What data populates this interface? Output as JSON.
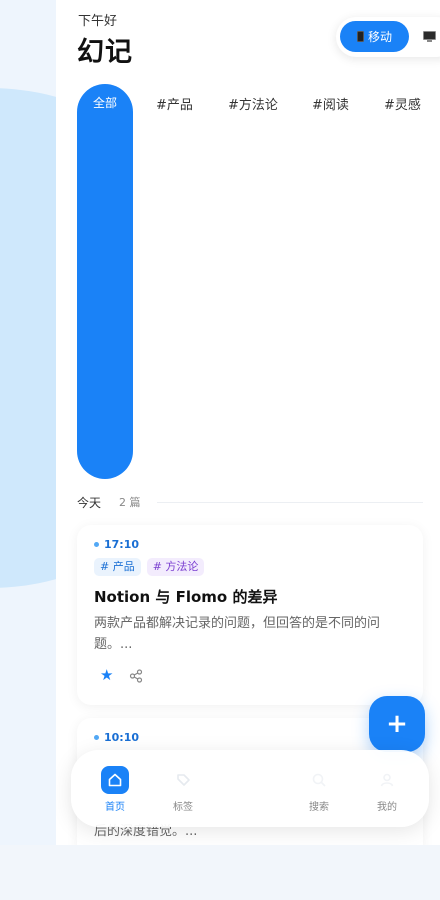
{
  "header": {
    "greeting": "下午好",
    "title": "幻记"
  },
  "view_switch": {
    "mobile_label": "移动",
    "active": "mobile"
  },
  "tags": {
    "active": "全部",
    "items": [
      "#产品",
      "#方法论",
      "#阅读",
      "#灵感"
    ]
  },
  "section": {
    "title": "今天",
    "count": "2 篇"
  },
  "notes": [
    {
      "time": "17:10",
      "tags": [
        "# 产品",
        "# 方法论"
      ],
      "title": "Notion 与 Flomo 的差异",
      "body": "两款产品都解决记录的问题，但回答的是不同的问题。..."
    },
    {
      "time": "10:10",
      "body_tail": "后的深度错觉。..."
    }
  ],
  "bottom_nav": {
    "items": [
      {
        "label": "首页",
        "icon": "home-icon",
        "active": true
      },
      {
        "label": "标签",
        "icon": "tag-icon",
        "active": false
      },
      {
        "label": "搜索",
        "icon": "search-icon",
        "active": false
      },
      {
        "label": "我的",
        "icon": "user-icon",
        "active": false
      }
    ]
  },
  "colors": {
    "accent": "#1a82f7",
    "tag_blue_bg": "#eaf3fd",
    "tag_purple_bg": "#f3ecfd",
    "tag_purple_text": "#7b3fd1",
    "page_bg": "#f2f6fb"
  }
}
